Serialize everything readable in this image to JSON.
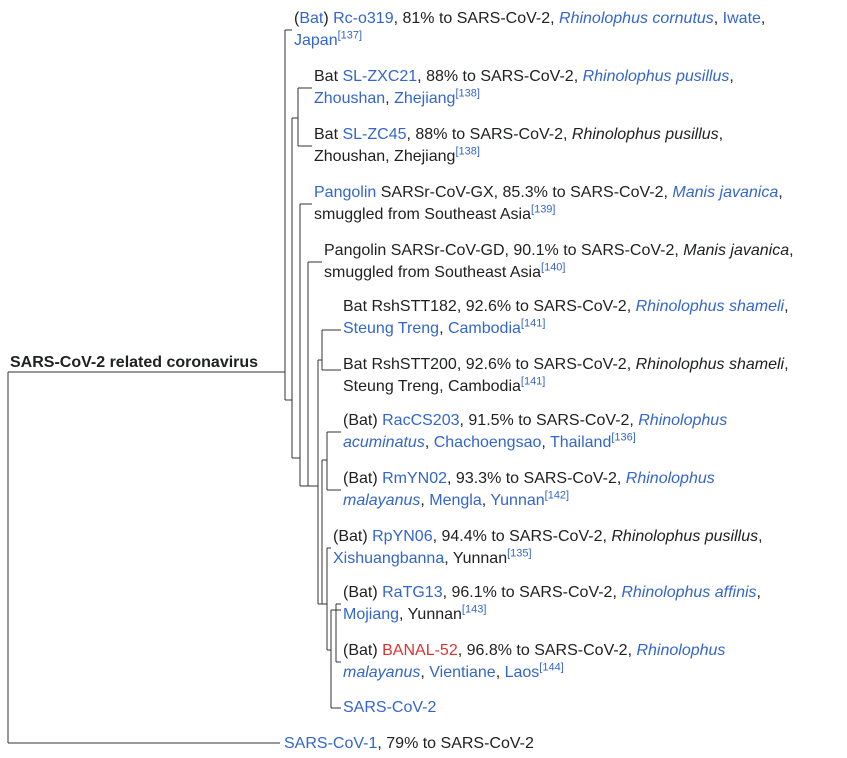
{
  "root_label": "SARS-CoV-2 related coronavirus",
  "leaves": [
    {
      "line1": [
        {
          "t": "("
        },
        {
          "t": "Bat",
          "c": "lnk"
        },
        {
          "t": ") "
        },
        {
          "t": "Rc-o319",
          "c": "lnk"
        },
        {
          "t": ", 81% to SARS-CoV-2, "
        },
        {
          "t": "Rhinolophus cornutus",
          "c": "lnk ital"
        },
        {
          "t": ", "
        },
        {
          "t": "Iwate",
          "c": "lnk"
        },
        {
          "t": ","
        }
      ],
      "line2": [
        {
          "t": "Japan",
          "c": "lnk"
        },
        {
          "t": "[137]",
          "sup": true
        }
      ]
    },
    {
      "line1": [
        {
          "t": "Bat "
        },
        {
          "t": "SL-ZXC21",
          "c": "lnk"
        },
        {
          "t": ", 88% to SARS-CoV-2, "
        },
        {
          "t": "Rhinolophus pusillus",
          "c": "lnk ital"
        },
        {
          "t": ","
        }
      ],
      "line2": [
        {
          "t": "Zhoushan",
          "c": "lnk"
        },
        {
          "t": ", "
        },
        {
          "t": "Zhejiang",
          "c": "lnk"
        },
        {
          "t": "[138]",
          "sup": true
        }
      ]
    },
    {
      "line1": [
        {
          "t": "Bat "
        },
        {
          "t": "SL-ZC45",
          "c": "lnk"
        },
        {
          "t": ", 88% to SARS-CoV-2, "
        },
        {
          "t": "Rhinolophus pusillus",
          "c": "ital"
        },
        {
          "t": ","
        }
      ],
      "line2": [
        {
          "t": "Zhoushan, Zhejiang"
        },
        {
          "t": "[138]",
          "sup": true
        }
      ]
    },
    {
      "line1": [
        {
          "t": "Pangolin",
          "c": "lnk"
        },
        {
          "t": " SARSr-CoV-GX, 85.3% to SARS-CoV-2, "
        },
        {
          "t": "Manis javanica",
          "c": "lnk ital"
        },
        {
          "t": ","
        }
      ],
      "line2": [
        {
          "t": "smuggled from Southeast Asia"
        },
        {
          "t": "[139]",
          "sup": true
        }
      ]
    },
    {
      "line1": [
        {
          "t": "Pangolin SARSr-CoV-GD, 90.1% to SARS-CoV-2, "
        },
        {
          "t": "Manis javanica",
          "c": "ital"
        },
        {
          "t": ","
        }
      ],
      "line2": [
        {
          "t": "smuggled from Southeast Asia"
        },
        {
          "t": "[140]",
          "sup": true
        }
      ]
    },
    {
      "line1": [
        {
          "t": "Bat RshSTT182, 92.6% to SARS-CoV-2, "
        },
        {
          "t": "Rhinolophus shameli",
          "c": "lnk ital"
        },
        {
          "t": ","
        }
      ],
      "line2": [
        {
          "t": "Steung Treng",
          "c": "lnk"
        },
        {
          "t": ", "
        },
        {
          "t": "Cambodia",
          "c": "lnk"
        },
        {
          "t": "[141]",
          "sup": true
        }
      ]
    },
    {
      "line1": [
        {
          "t": "Bat RshSTT200, 92.6% to SARS-CoV-2, "
        },
        {
          "t": "Rhinolophus shameli",
          "c": "ital"
        },
        {
          "t": ","
        }
      ],
      "line2": [
        {
          "t": "Steung Treng, Cambodia"
        },
        {
          "t": "[141]",
          "sup": true
        }
      ]
    },
    {
      "line1": [
        {
          "t": "(Bat) "
        },
        {
          "t": "RacCS203",
          "c": "lnk"
        },
        {
          "t": ", 91.5% to SARS-CoV-2, "
        },
        {
          "t": "Rhinolophus",
          "c": "lnk ital"
        }
      ],
      "line2": [
        {
          "t": "acuminatus",
          "c": "lnk ital"
        },
        {
          "t": ", "
        },
        {
          "t": "Chachoengsao",
          "c": "lnk"
        },
        {
          "t": ", "
        },
        {
          "t": "Thailand",
          "c": "lnk"
        },
        {
          "t": "[136]",
          "sup": true
        }
      ]
    },
    {
      "line1": [
        {
          "t": "(Bat) "
        },
        {
          "t": "RmYN02",
          "c": "lnk"
        },
        {
          "t": ", 93.3% to SARS-CoV-2, "
        },
        {
          "t": "Rhinolophus",
          "c": "lnk ital"
        }
      ],
      "line2": [
        {
          "t": "malayanus",
          "c": "lnk ital"
        },
        {
          "t": ", "
        },
        {
          "t": "Mengla",
          "c": "lnk"
        },
        {
          "t": ", "
        },
        {
          "t": "Yunnan",
          "c": "lnk"
        },
        {
          "t": "[142]",
          "sup": true
        }
      ]
    },
    {
      "line1": [
        {
          "t": "(Bat) "
        },
        {
          "t": "RpYN06",
          "c": "lnk"
        },
        {
          "t": ", 94.4% to SARS-CoV-2, "
        },
        {
          "t": "Rhinolophus pusillus",
          "c": "ital"
        },
        {
          "t": ","
        }
      ],
      "line2": [
        {
          "t": "Xishuangbanna",
          "c": "lnk"
        },
        {
          "t": ", Yunnan"
        },
        {
          "t": "[135]",
          "sup": true
        }
      ]
    },
    {
      "line1": [
        {
          "t": "(Bat) "
        },
        {
          "t": "RaTG13",
          "c": "lnk"
        },
        {
          "t": ", 96.1% to SARS-CoV-2, "
        },
        {
          "t": "Rhinolophus affinis",
          "c": "lnk ital"
        },
        {
          "t": ","
        }
      ],
      "line2": [
        {
          "t": "Mojiang",
          "c": "lnk"
        },
        {
          "t": ", Yunnan"
        },
        {
          "t": "[143]",
          "sup": true
        }
      ]
    },
    {
      "line1": [
        {
          "t": "(Bat) "
        },
        {
          "t": "BANAL-52",
          "c": "red"
        },
        {
          "t": ", 96.8% to SARS-CoV-2, "
        },
        {
          "t": "Rhinolophus",
          "c": "lnk ital"
        }
      ],
      "line2": [
        {
          "t": "malayanus",
          "c": "lnk ital"
        },
        {
          "t": ", "
        },
        {
          "t": "Vientiane",
          "c": "lnk"
        },
        {
          "t": ", "
        },
        {
          "t": "Laos",
          "c": "lnk"
        },
        {
          "t": "[144]",
          "sup": true
        }
      ]
    },
    {
      "line1": [
        {
          "t": "SARS-CoV-2",
          "c": "lnk"
        }
      ]
    },
    {
      "line1": [
        {
          "t": "SARS-CoV-1",
          "c": "lnk"
        },
        {
          "t": ", 79% to SARS-CoV-2"
        }
      ]
    }
  ],
  "colors": {
    "link": "#3366cc",
    "red_link": "#dd3333",
    "text": "#202122",
    "line": "#333333"
  }
}
